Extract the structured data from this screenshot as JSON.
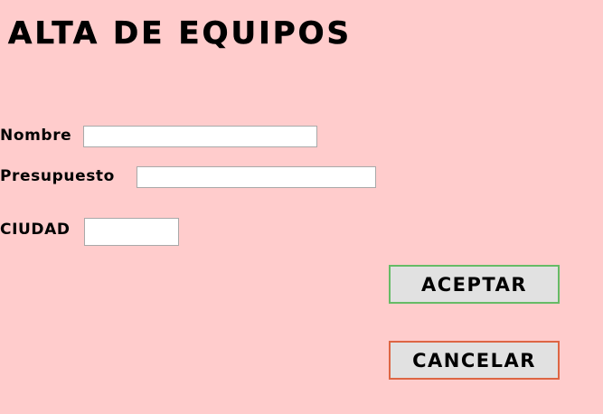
{
  "page": {
    "title": "ALTA DE EQUIPOS"
  },
  "form": {
    "nombre_label": "Nombre",
    "nombre_value": "",
    "presupuesto_label": "Presupuesto",
    "presupuesto_value": "",
    "ciudad_label": "CIUDAD",
    "ciudad_value": ""
  },
  "actions": {
    "accept_label": "ACEPTAR",
    "cancel_label": "CANCELAR"
  },
  "colors": {
    "background": "#ffcccc",
    "accept_border": "#66bb66",
    "cancel_border": "#dd6644",
    "button_face": "#e1e1e1"
  }
}
